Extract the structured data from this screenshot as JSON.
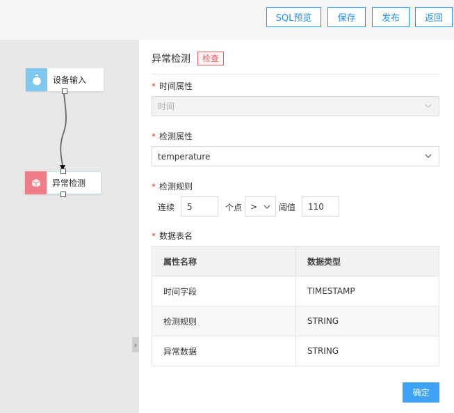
{
  "toolbar": {
    "sql_preview": "SQL预览",
    "save": "保存",
    "publish": "发布",
    "back": "返回"
  },
  "canvas": {
    "nodes": [
      {
        "label": "设备输入",
        "icon": "timer-icon",
        "color": "#7ec8ef"
      },
      {
        "label": "异常检测",
        "icon": "cube-icon",
        "color": "#f07c86"
      }
    ],
    "collapse_glyph": "›"
  },
  "panel": {
    "title": "异常检测",
    "tag": "检查",
    "time_attr": {
      "label": "时间属性",
      "value": "时间",
      "disabled": true
    },
    "detect_attr": {
      "label": "检测属性",
      "value": "temperature"
    },
    "detect_rule": {
      "label": "检测规则",
      "prefix": "连续",
      "count": "5",
      "unit": "个点",
      "operator": ">",
      "threshold_label": "阈值",
      "threshold": "110"
    },
    "table_name_label": "数据表名",
    "table": {
      "headers": [
        "属性名称",
        "数据类型"
      ],
      "rows": [
        [
          "时间字段",
          "TIMESTAMP"
        ],
        [
          "检测规则",
          "STRING"
        ],
        [
          "异常数据",
          "STRING"
        ]
      ]
    },
    "confirm": "确定",
    "required_mark": "*"
  }
}
